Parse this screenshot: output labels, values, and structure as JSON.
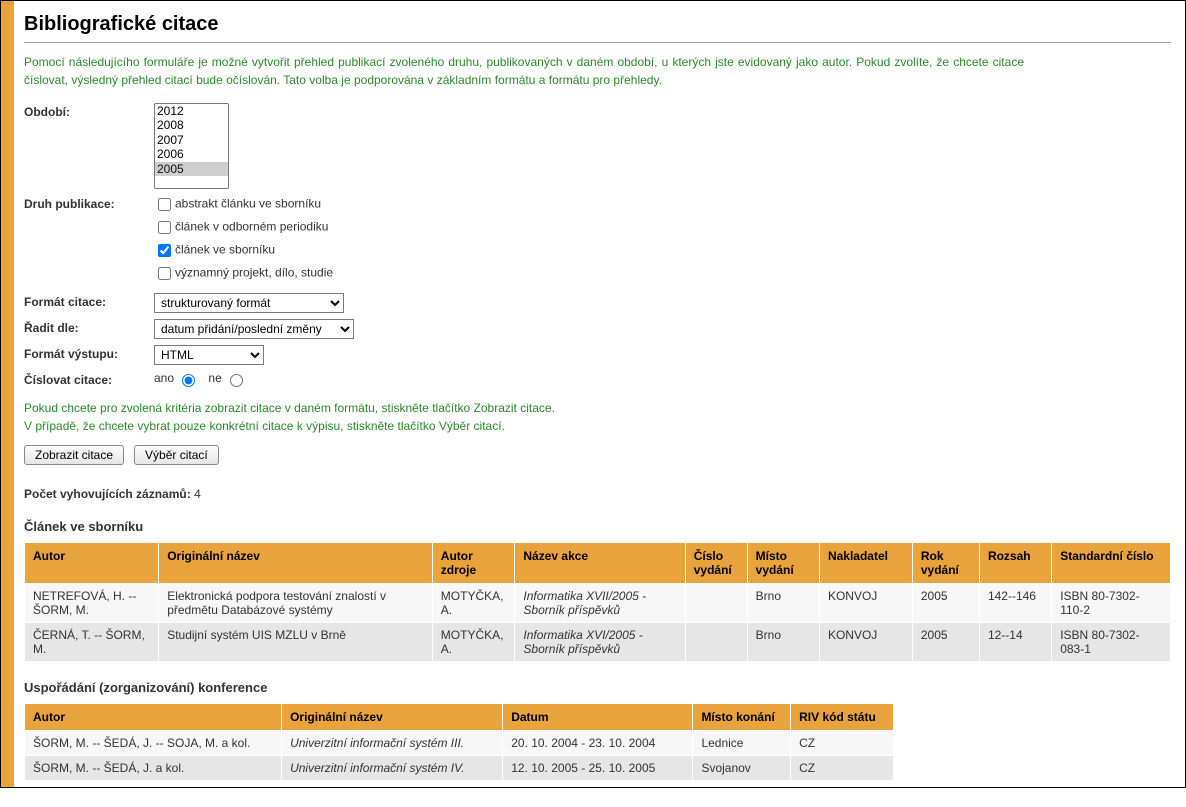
{
  "title": "Bibliografické citace",
  "intro_lines": [
    "Pomocí následujícího formuláře je možné vytvořit přehled publikací zvoleného druhu, publikovaných v daném období, u kterých jste evidovaný jako autor. Pokud zvolíte, že chcete citace číslovat, výsledný přehled citací bude očíslován. Tato volba je podporována v základním formátu a formátu pro přehledy."
  ],
  "form": {
    "period_label": "Období:",
    "period_options": [
      "2012",
      "2008",
      "2007",
      "2006",
      "2005"
    ],
    "period_selected": "2005",
    "pubtype_label": "Druh publikace:",
    "pubtypes": [
      {
        "label": "abstrakt článku ve sborníku",
        "checked": false
      },
      {
        "label": "článek v odborném periodiku",
        "checked": false
      },
      {
        "label": "článek ve sborníku",
        "checked": true
      },
      {
        "label": "významný projekt, dílo, studie",
        "checked": false
      }
    ],
    "citation_format_label": "Formát citace:",
    "citation_format_value": "strukturovaný formát",
    "sort_label": "Řadit dle:",
    "sort_value": "datum přidání/poslední změny",
    "output_format_label": "Formát výstupu:",
    "output_format_value": "HTML",
    "numbering_label": "Číslovat citace:",
    "numbering_yes": "ano",
    "numbering_no": "ne"
  },
  "hint_lines": [
    "Pokud chcete pro zvolená kritéria zobrazit citace v daném formátu, stiskněte tlačítko Zobrazit citace.",
    "V případě, že chcete vybrat pouze konkrétní citace k výpisu, stiskněte tlačítko Výběr citací."
  ],
  "buttons": {
    "show": "Zobrazit citace",
    "select": "Výběr citací"
  },
  "result_count_label": "Počet vyhovujících záznamů:",
  "result_count_value": "4",
  "section1": {
    "title": "Článek ve sborníku",
    "headers": [
      "Autor",
      "Originální název",
      "Autor zdroje",
      "Název akce",
      "Číslo vydání",
      "Místo vydání",
      "Nakladatel",
      "Rok vydání",
      "Rozsah",
      "Standardní číslo"
    ],
    "rows": [
      {
        "autor": "NETREFOVÁ, H. -- ŠORM, M.",
        "nazev": "Elektronická podpora testování znalostí v předmětu Databázové systémy",
        "autor_zdroje": "MOTYČKA, A.",
        "nazev_akce": "Informatika XVII/2005 - Sborník příspěvků",
        "cislo": "",
        "misto": "Brno",
        "nakladatel": "KONVOJ",
        "rok": "2005",
        "rozsah": "142--146",
        "isbn": "ISBN 80-7302-110-2"
      },
      {
        "autor": "ČERNÁ, T. -- ŠORM, M.",
        "nazev": "Studijní systém UIS MZLU v Brně",
        "autor_zdroje": "MOTYČKA, A.",
        "nazev_akce": "Informatika XVI/2005 - Sborník příspěvků",
        "cislo": "",
        "misto": "Brno",
        "nakladatel": "KONVOJ",
        "rok": "2005",
        "rozsah": "12--14",
        "isbn": "ISBN 80-7302-083-1"
      }
    ]
  },
  "section2": {
    "title": "Uspořádání (zorganizování) konference",
    "headers": [
      "Autor",
      "Originální název",
      "Datum",
      "Místo konání",
      "RIV kód státu"
    ],
    "rows": [
      {
        "autor": "ŠORM, M. -- ŠEDÁ, J. -- SOJA, M. a kol.",
        "nazev": "Univerzitní informační systém III.",
        "datum": "20. 10. 2004 - 23. 10. 2004",
        "misto": "Lednice",
        "riv": "CZ"
      },
      {
        "autor": "ŠORM, M. -- ŠEDÁ, J. a kol.",
        "nazev": "Univerzitní informační systém IV.",
        "datum": "12. 10. 2005 - 25. 10. 2005",
        "misto": "Svojanov",
        "riv": "CZ"
      }
    ]
  }
}
